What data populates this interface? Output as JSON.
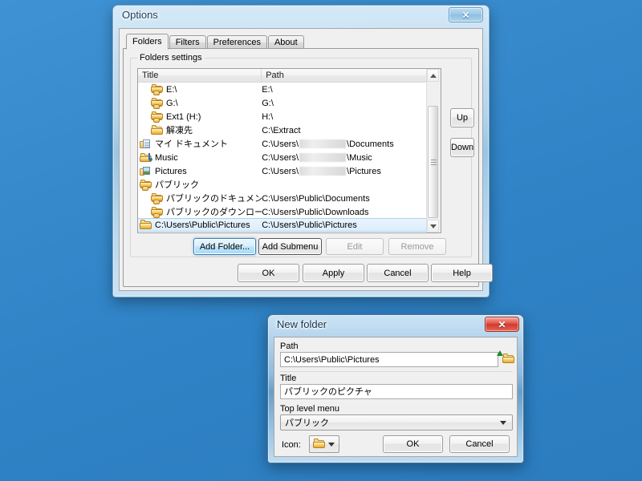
{
  "options_window": {
    "title": "Options",
    "close_icon": "close-icon",
    "tabs": [
      {
        "label": "Folders",
        "selected": true
      },
      {
        "label": "Filters",
        "selected": false
      },
      {
        "label": "Preferences",
        "selected": false
      },
      {
        "label": "About",
        "selected": false
      }
    ],
    "group_title": "Folders settings",
    "columns": [
      "Title",
      "Path"
    ],
    "rows": [
      {
        "indent": 1,
        "icon": "shared-folder-icon",
        "title": "E:\\",
        "path": "E:\\",
        "redacted": false,
        "selected": false
      },
      {
        "indent": 1,
        "icon": "shared-folder-icon",
        "title": "G:\\",
        "path": "G:\\",
        "redacted": false,
        "selected": false
      },
      {
        "indent": 1,
        "icon": "shared-folder-icon",
        "title": "Ext1 (H:)",
        "path": "H:\\",
        "redacted": false,
        "selected": false
      },
      {
        "indent": 1,
        "icon": "folder-icon",
        "title": "解凍先",
        "path": "C:\\Extract",
        "redacted": false,
        "selected": false
      },
      {
        "indent": 0,
        "icon": "documents-folder-icon",
        "title": "マイ ドキュメント",
        "path_prefix": "C:\\Users\\",
        "path_suffix": "\\Documents",
        "redacted": true,
        "selected": false
      },
      {
        "indent": 0,
        "icon": "music-folder-icon",
        "title": "Music",
        "path_prefix": "C:\\Users\\",
        "path_suffix": "\\Music",
        "redacted": true,
        "selected": false
      },
      {
        "indent": 0,
        "icon": "pictures-folder-icon",
        "title": "Pictures",
        "path_prefix": "C:\\Users\\",
        "path_suffix": "\\Pictures",
        "redacted": true,
        "selected": false
      },
      {
        "indent": 0,
        "icon": "shared-folder-icon",
        "title": "パブリック",
        "path": "",
        "redacted": false,
        "selected": false
      },
      {
        "indent": 1,
        "icon": "shared-folder-icon",
        "title": "パブリックのドキュメント",
        "path": "C:\\Users\\Public\\Documents",
        "redacted": false,
        "selected": false
      },
      {
        "indent": 1,
        "icon": "shared-folder-icon",
        "title": "パブリックのダウンロード",
        "path": "C:\\Users\\Public\\Downloads",
        "redacted": false,
        "selected": false
      },
      {
        "indent": 0,
        "icon": "folder-icon",
        "title": "C:\\Users\\Public\\Pictures",
        "path": "C:\\Users\\Public\\Pictures",
        "redacted": false,
        "selected": true
      }
    ],
    "side_buttons": [
      {
        "label": "Up",
        "disabled": false
      },
      {
        "label": "Down",
        "disabled": false
      }
    ],
    "list_buttons": [
      {
        "label": "Add Folder...",
        "state": "default"
      },
      {
        "label": "Add Submenu",
        "state": "focus"
      },
      {
        "label": "Edit",
        "state": "disabled"
      },
      {
        "label": "Remove",
        "state": "disabled"
      }
    ],
    "dialog_buttons": [
      {
        "label": "OK"
      },
      {
        "label": "Apply"
      },
      {
        "label": "Cancel"
      },
      {
        "label": "Help"
      }
    ]
  },
  "new_folder_window": {
    "title": "New folder",
    "close_icon": "close-icon",
    "path_label": "Path",
    "path_value": "C:\\Users\\Public\\Pictures",
    "browse_icon": "open-folder-browse-icon",
    "title_label": "Title",
    "title_value": "パブリックのピクチャ",
    "menu_label": "Top level menu",
    "menu_value": "パブリック",
    "icon_label": "Icon:",
    "icon_value": "folder-icon",
    "buttons": [
      {
        "label": "OK"
      },
      {
        "label": "Cancel"
      }
    ]
  },
  "colors": {
    "desktop": "#3288c8",
    "accent_selected": "#dcedfc",
    "selection_border": "#a9d3f2",
    "close_danger": "#cf3b2c",
    "folder_yellow": "#f0c04e"
  }
}
